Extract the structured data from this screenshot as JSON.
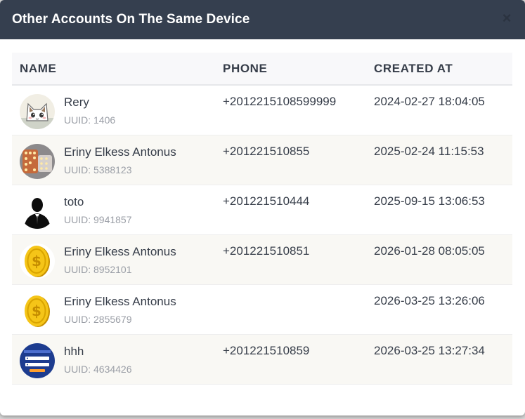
{
  "modal": {
    "title": "Other Accounts On The Same Device",
    "close_label": "×"
  },
  "table": {
    "columns": [
      "NAME",
      "PHONE",
      "CREATED AT"
    ],
    "uuid_prefix": "UUID: ",
    "rows": [
      {
        "name": "Rery",
        "uuid": "1406",
        "phone": "+2012215108599999",
        "created_at": "2024-02-27 18:04:05",
        "avatar": "cat-avatar"
      },
      {
        "name": "Eriny Elkess Antonus",
        "uuid": "5388123",
        "phone": "+201221510855",
        "created_at": "2025-02-24 11:15:53",
        "avatar": "marquee-letters-avatar"
      },
      {
        "name": "toto",
        "uuid": "9941857",
        "phone": "+201221510444",
        "created_at": "2025-09-15 13:06:53",
        "avatar": "person-silhouette-avatar"
      },
      {
        "name": "Eriny Elkess Antonus",
        "uuid": "8952101",
        "phone": "+201221510851",
        "created_at": "2026-01-28 08:05:05",
        "avatar": "gold-coin-avatar"
      },
      {
        "name": "Eriny Elkess Antonus",
        "uuid": "2855679",
        "phone": "",
        "created_at": "2026-03-25 13:26:06",
        "avatar": "gold-coin-avatar"
      },
      {
        "name": "hhh",
        "uuid": "4634426",
        "phone": "+201221510859",
        "created_at": "2026-03-25 13:27:34",
        "avatar": "login-screen-avatar"
      }
    ]
  }
}
